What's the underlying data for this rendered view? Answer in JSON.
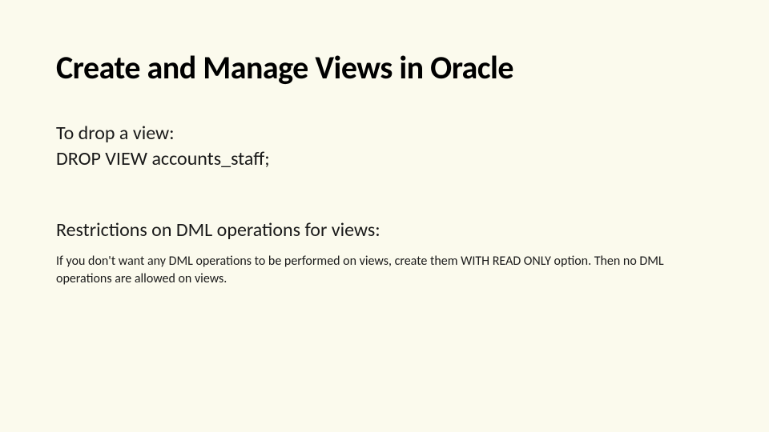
{
  "title": "Create and Manage Views in Oracle",
  "intro_line1": "To drop a view:",
  "intro_line2": "DROP VIEW accounts_staff;",
  "subheading": "Restrictions on DML operations for views:",
  "detail": "If you don't want any DML operations to be performed on views, create them WITH READ ONLY option. Then no DML operations are allowed on views."
}
